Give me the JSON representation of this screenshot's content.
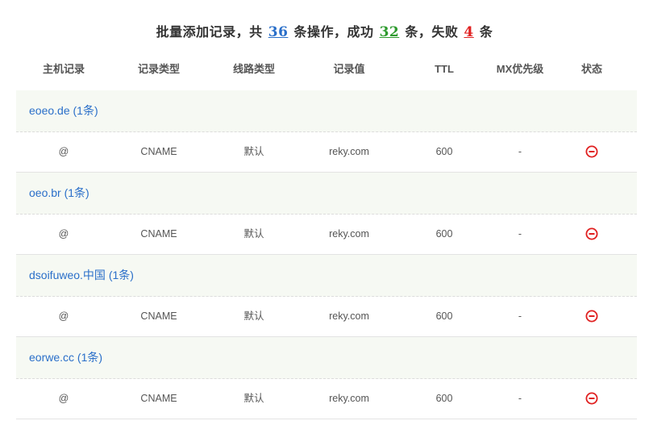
{
  "summary": {
    "prefix": "批量添加记录，共",
    "total": "36",
    "mid1": "条操作，成功",
    "success": "32",
    "mid2": "条，失败",
    "failed": "4",
    "suffix": "条"
  },
  "columns": [
    "主机记录",
    "记录类型",
    "线路类型",
    "记录值",
    "TTL",
    "MX优先级",
    "状态"
  ],
  "groups": [
    {
      "title": "eoeo.de (1条)",
      "record": {
        "host": "@",
        "type": "CNAME",
        "line": "默认",
        "value": "reky.com",
        "ttl": "600",
        "mx": "-",
        "status_icon": "remove-circle-icon"
      }
    },
    {
      "title": "oeo.br (1条)",
      "record": {
        "host": "@",
        "type": "CNAME",
        "line": "默认",
        "value": "reky.com",
        "ttl": "600",
        "mx": "-",
        "status_icon": "remove-circle-icon"
      }
    },
    {
      "title": "dsoifuweo.中国 (1条)",
      "record": {
        "host": "@",
        "type": "CNAME",
        "line": "默认",
        "value": "reky.com",
        "ttl": "600",
        "mx": "-",
        "status_icon": "remove-circle-icon"
      }
    },
    {
      "title": "eorwe.cc (1条)",
      "record": {
        "host": "@",
        "type": "CNAME",
        "line": "默认",
        "value": "reky.com",
        "ttl": "600",
        "mx": "-",
        "status_icon": "remove-circle-icon"
      }
    }
  ],
  "colors": {
    "link": "#2a6fc9",
    "success": "#2e9a2e",
    "fail": "#e02020",
    "group_bg": "#f6f9f3"
  }
}
